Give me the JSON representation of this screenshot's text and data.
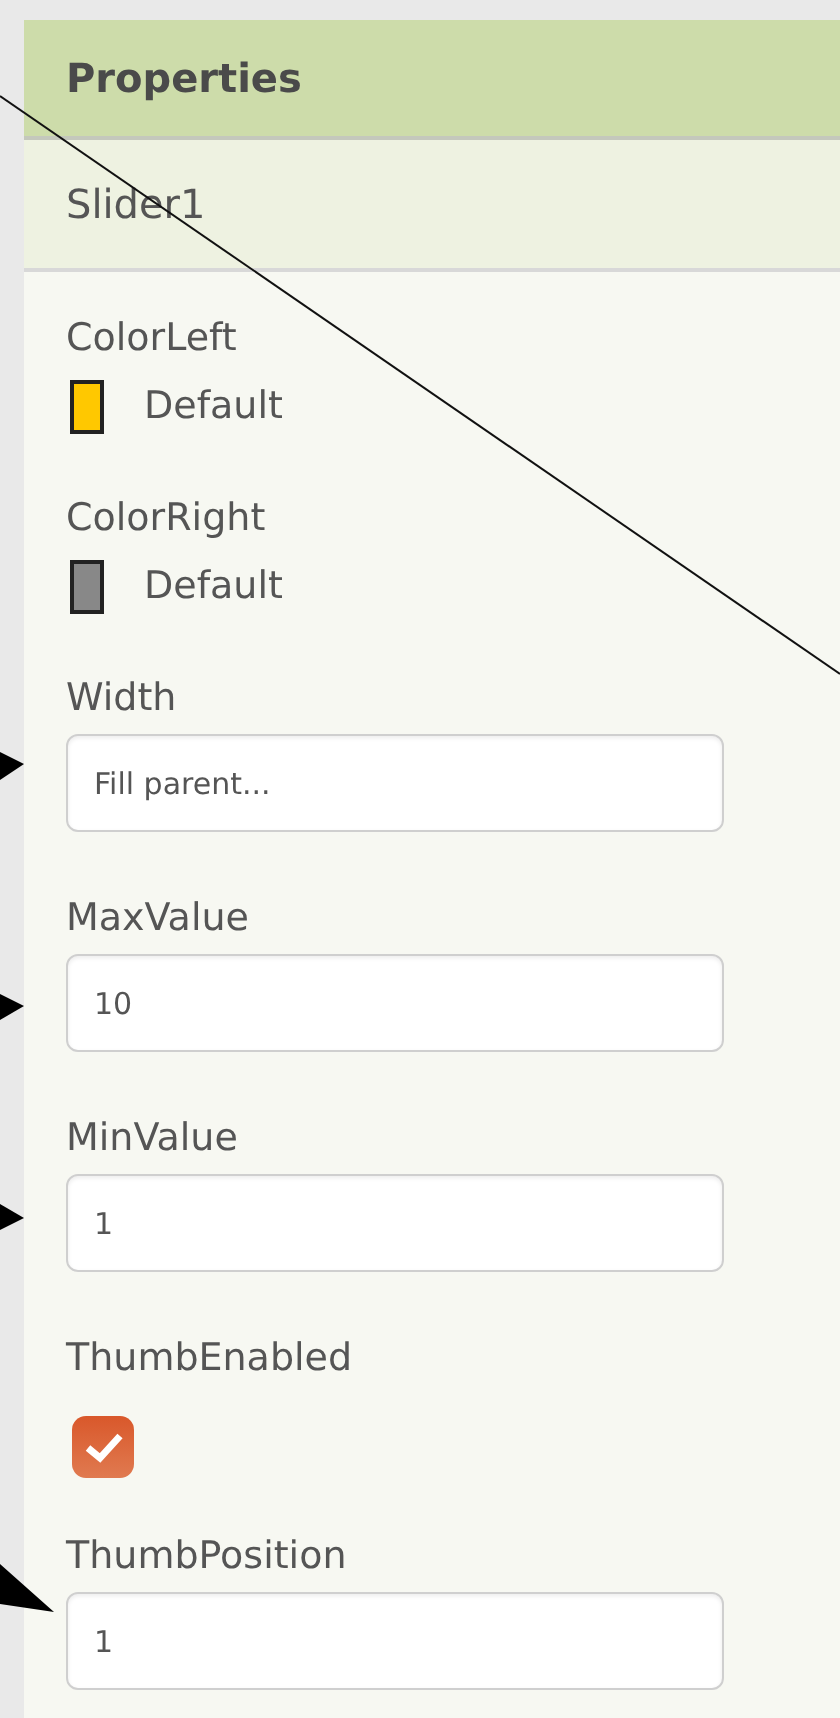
{
  "panel": {
    "title": "Properties",
    "component": "Slider1"
  },
  "properties": [
    {
      "kind": "color",
      "label": "ColorLeft",
      "value": "Default",
      "color": "#ffc800"
    },
    {
      "kind": "color",
      "label": "ColorRight",
      "value": "Default",
      "color": "#888888"
    },
    {
      "kind": "text",
      "label": "Width",
      "value": "Fill parent..."
    },
    {
      "kind": "text",
      "label": "MaxValue",
      "value": "10"
    },
    {
      "kind": "text",
      "label": "MinValue",
      "value": "1"
    },
    {
      "kind": "checkbox",
      "label": "ThumbEnabled",
      "checked": true
    },
    {
      "kind": "text",
      "label": "ThumbPosition",
      "value": "1"
    }
  ]
}
